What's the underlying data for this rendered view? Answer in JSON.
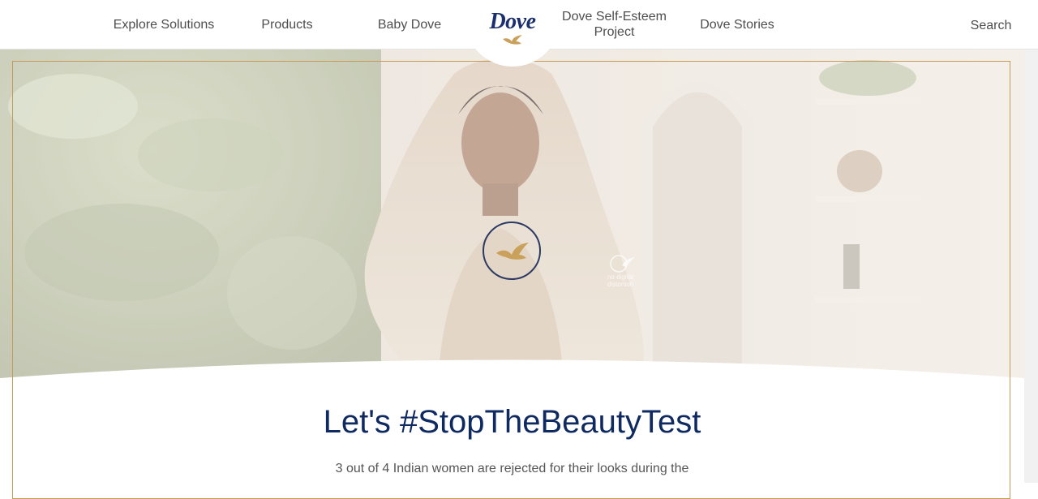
{
  "nav": {
    "explore": "Explore Solutions",
    "products": "Products",
    "baby": "Baby Dove",
    "self_esteem": "Dove Self-Esteem Project",
    "stories": "Dove Stories",
    "search": "Search"
  },
  "logo": {
    "text": "Dove"
  },
  "hero": {
    "watermark_line1": "no digital",
    "watermark_line2": "distortion"
  },
  "content": {
    "headline": "Let's #StopTheBeautyTest",
    "subtext": "3 out of 4 Indian women are rejected for their looks during the"
  },
  "colors": {
    "brand_navy": "#0e2a61",
    "gold_accent": "#c49a55",
    "logo_navy": "#1b2f6e"
  },
  "icons": {
    "logo_bird": "dove-bird-icon",
    "play": "video-play-icon"
  }
}
